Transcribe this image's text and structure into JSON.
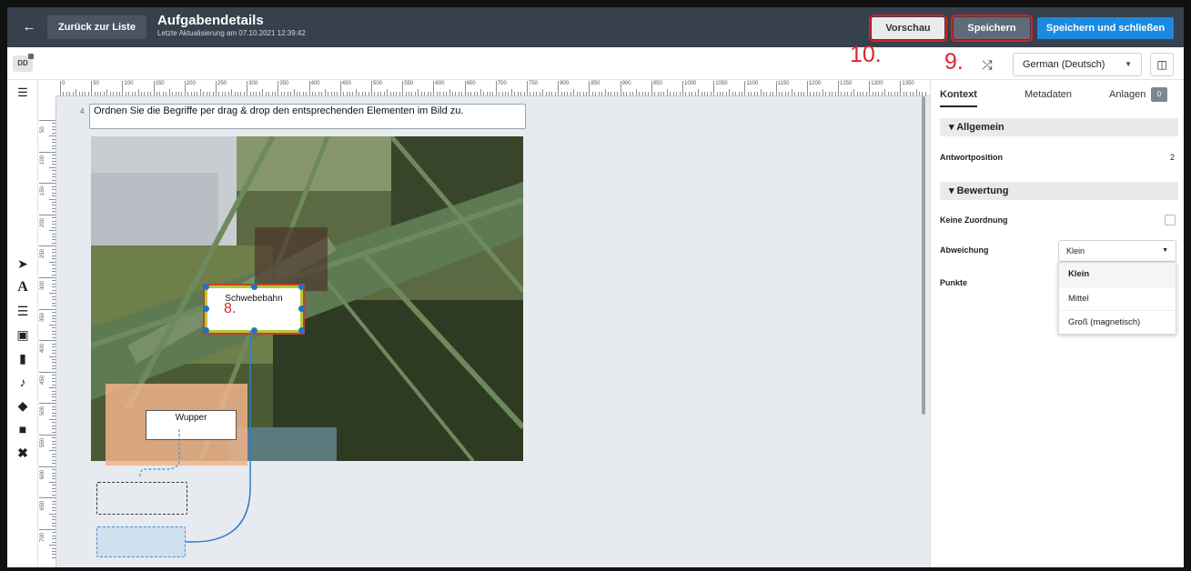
{
  "header": {
    "back_label": "Zurück zur Liste",
    "title": "Aufgabendetails",
    "subtitle": "Letzte Aktualisierung am 07.10.2021 12:39:42",
    "preview_label": "Vorschau",
    "save_label": "Speichern",
    "save_close_label": "Speichern und schließen"
  },
  "toolbar": {
    "badge": "DD",
    "language": "German (Deutsch)"
  },
  "annotations": {
    "a8": "8.",
    "a9": "9.",
    "a10": "10."
  },
  "ruler": {
    "h_labels": [
      "0",
      "50",
      "100",
      "150",
      "200",
      "250",
      "300",
      "350",
      "400",
      "450",
      "500",
      "550",
      "600",
      "650",
      "700",
      "750",
      "800",
      "850",
      "900",
      "950",
      "1000",
      "1050",
      "1100",
      "1150",
      "1200",
      "1250",
      "1300",
      "1350"
    ],
    "v_labels": [
      "50",
      "100",
      "150",
      "200",
      "250",
      "300",
      "350",
      "400",
      "450",
      "500",
      "550",
      "600",
      "650",
      "700"
    ]
  },
  "canvas": {
    "question_number": "4",
    "question_text": "Ordnen Sie die Begriffe per drag & drop den entsprechenden Elementen im Bild zu.",
    "targets": {
      "schwebebahn": "Schwebebahn",
      "wupper": "Wupper"
    }
  },
  "panel": {
    "tabs": {
      "kontext": "Kontext",
      "metadaten": "Metadaten",
      "anlagen": "Anlagen",
      "anlagen_count": "0"
    },
    "section_allgemein": "Allgemein",
    "antwortposition_label": "Antwortposition",
    "antwortposition_value": "2",
    "section_bewertung": "Bewertung",
    "keine_zuordnung_label": "Keine Zuordnung",
    "abweichung_label": "Abweichung",
    "abweichung_value": "Klein",
    "abweichung_options": [
      "Klein",
      "Mittel",
      "Groß (magnetisch)"
    ],
    "punkte_label": "Punkte"
  },
  "icons": {
    "left_tools": [
      "cursor-icon",
      "text-icon",
      "checklist-icon",
      "image-icon",
      "video-icon",
      "audio-icon",
      "tag-icon",
      "comment-icon",
      "delete-icon"
    ]
  }
}
